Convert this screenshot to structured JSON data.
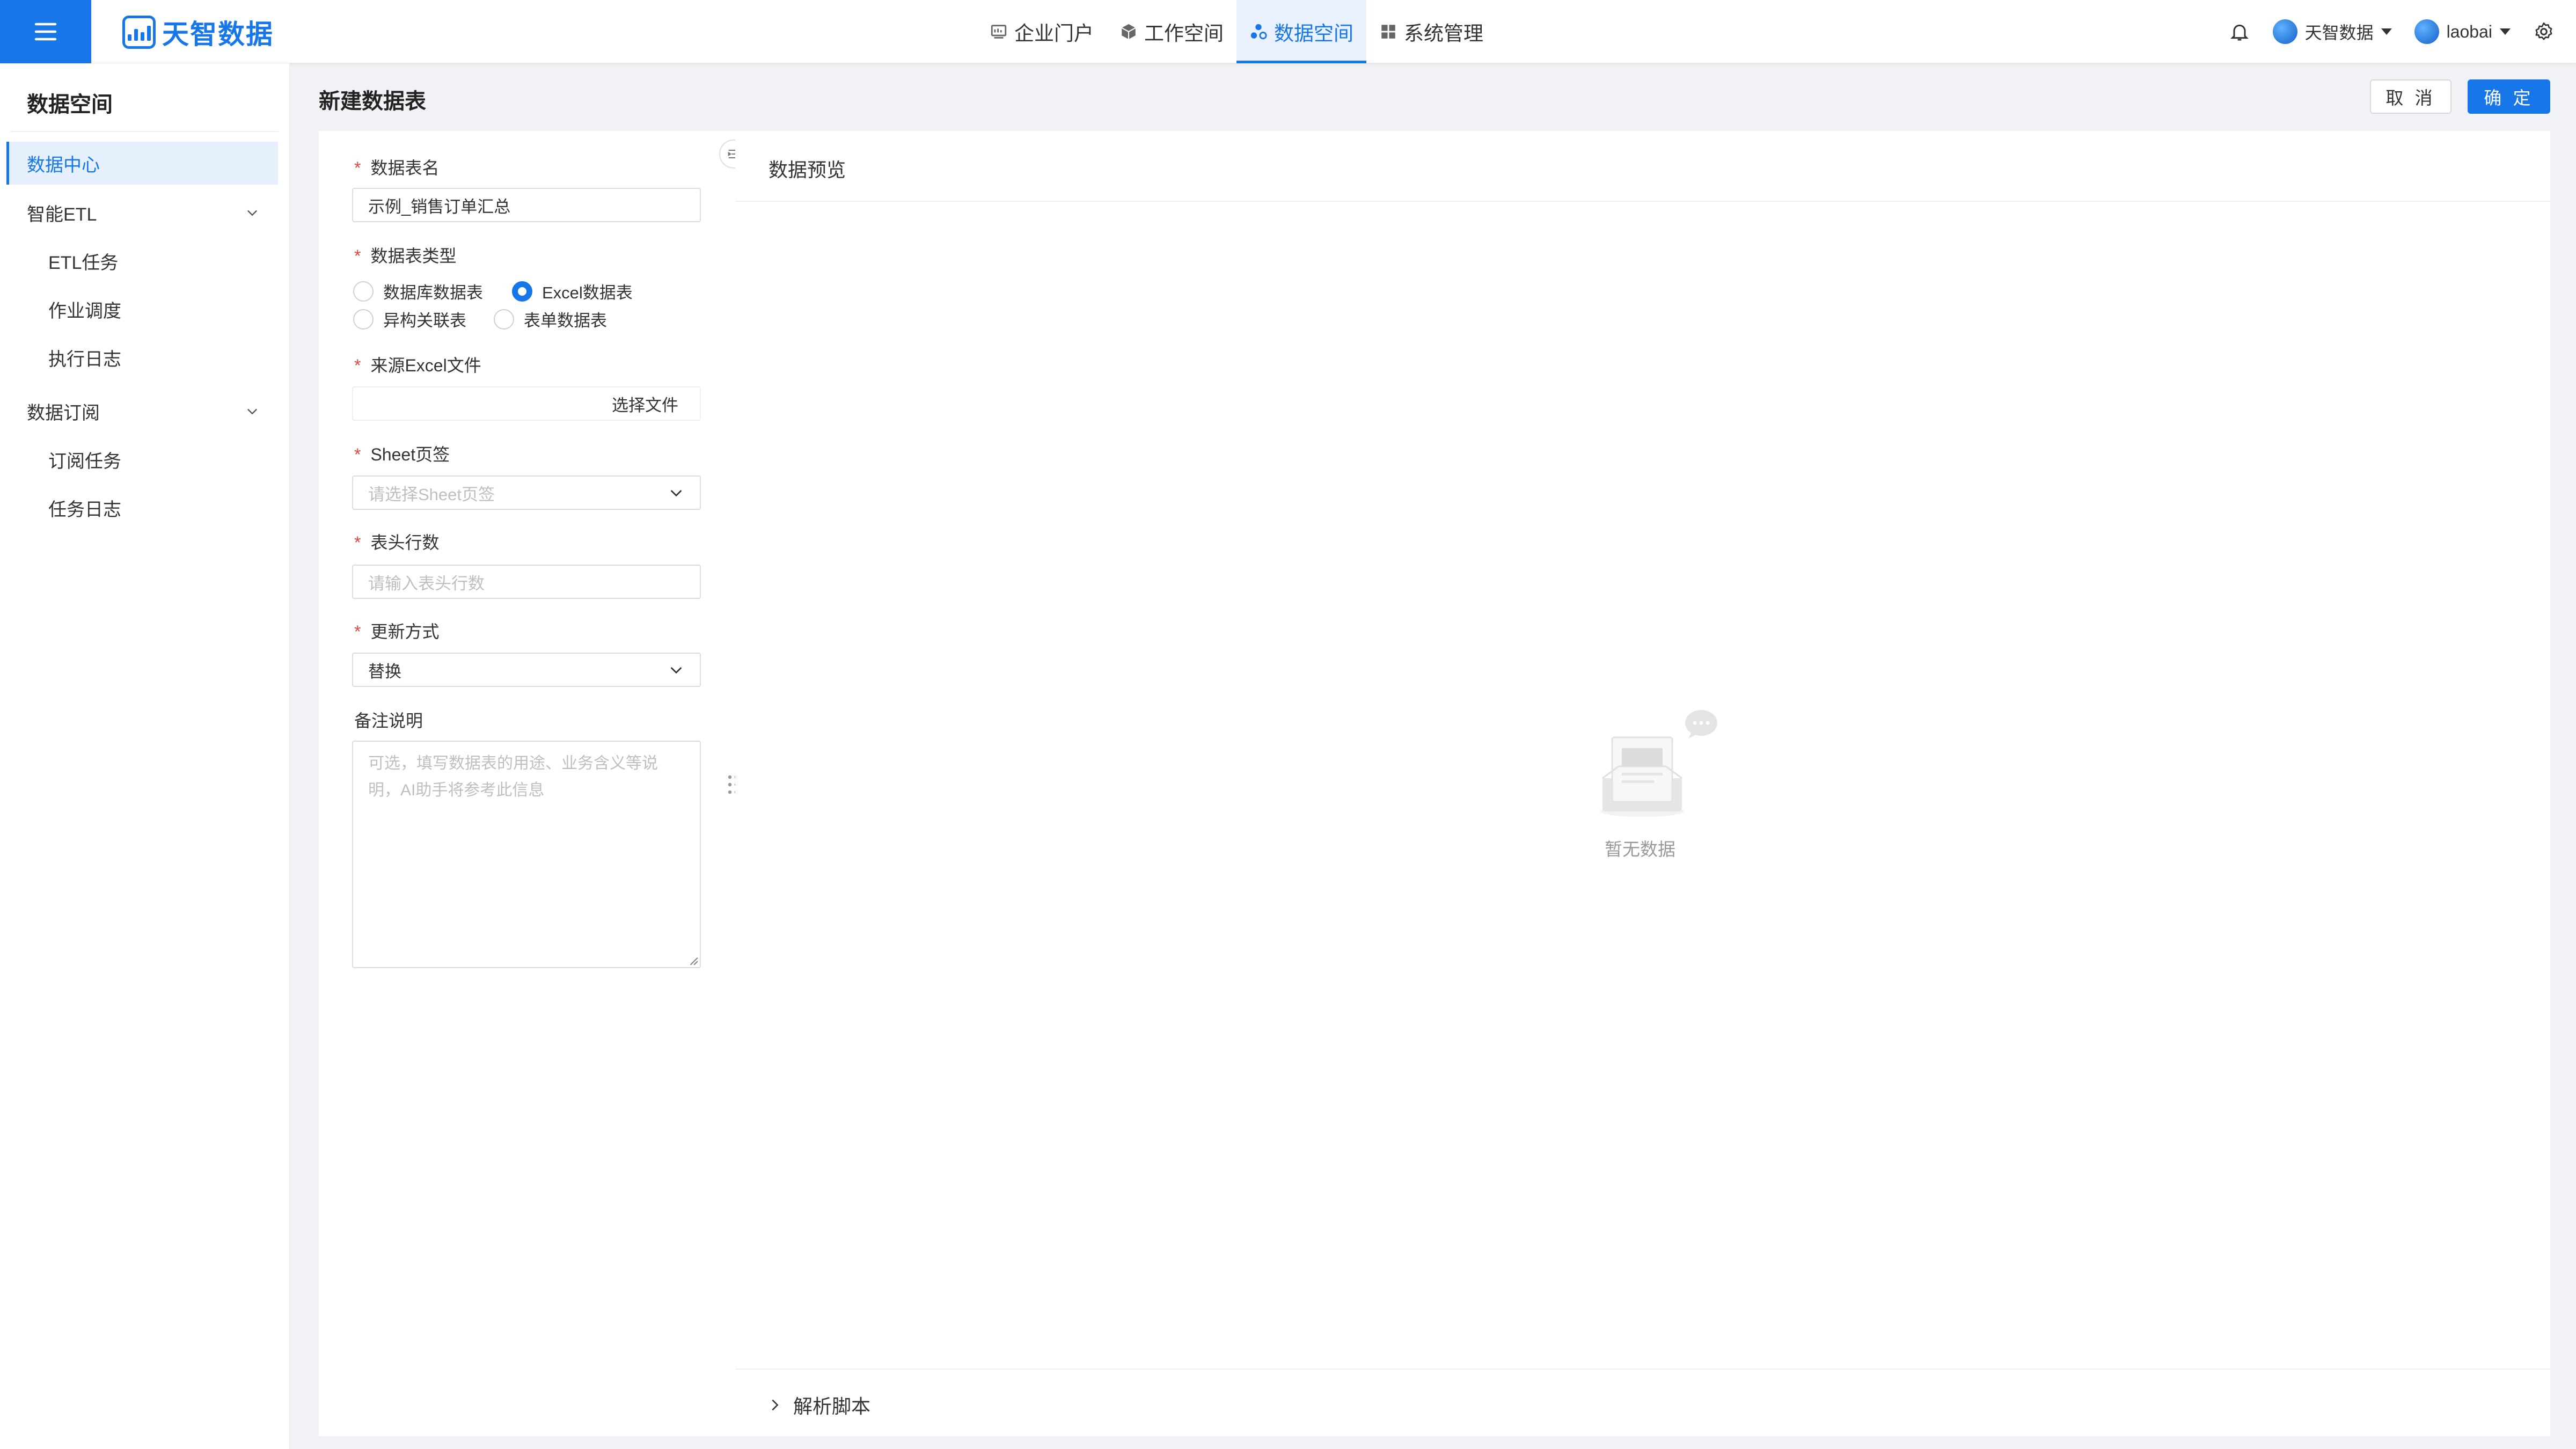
{
  "app": {
    "logo_text": "天智数据"
  },
  "nav": {
    "items": [
      {
        "label": "企业门户",
        "icon": "portal-icon"
      },
      {
        "label": "工作空间",
        "icon": "cube-icon"
      },
      {
        "label": "数据空间",
        "icon": "data-space-icon",
        "active": true
      },
      {
        "label": "系统管理",
        "icon": "grid-icon"
      }
    ]
  },
  "topright": {
    "org": "天智数据",
    "user": "laobai"
  },
  "sidebar": {
    "title": "数据空间",
    "items": [
      {
        "label": "数据中心",
        "active": true
      },
      {
        "label": "智能ETL",
        "expandable": true
      },
      {
        "label": "ETL任务",
        "sub": true
      },
      {
        "label": "作业调度",
        "sub": true
      },
      {
        "label": "执行日志",
        "sub": true
      },
      {
        "label": "数据订阅",
        "expandable": true
      },
      {
        "label": "订阅任务",
        "sub": true
      },
      {
        "label": "任务日志",
        "sub": true
      }
    ]
  },
  "page": {
    "title": "新建数据表",
    "cancel": "取 消",
    "ok": "确 定"
  },
  "form": {
    "name_label": "数据表名",
    "name_value": "示例_销售订单汇总",
    "type_label": "数据表类型",
    "type_options": [
      "数据库数据表",
      "Excel数据表",
      "异构关联表",
      "表单数据表"
    ],
    "type_selected": "Excel数据表",
    "file_label": "来源Excel文件",
    "file_button": "选择文件",
    "sheet_label": "Sheet页签",
    "sheet_placeholder": "请选择Sheet页签",
    "header_label": "表头行数",
    "header_placeholder": "请输入表头行数",
    "update_label": "更新方式",
    "update_value": "替换",
    "note_label": "备注说明",
    "note_placeholder": "可选，填写数据表的用途、业务含义等说明，AI助手将参考此信息"
  },
  "preview": {
    "title": "数据预览",
    "empty_text": "暂无数据",
    "script_label": "解析脚本"
  },
  "colors": {
    "primary": "#1777e8",
    "required": "#e8453c"
  }
}
